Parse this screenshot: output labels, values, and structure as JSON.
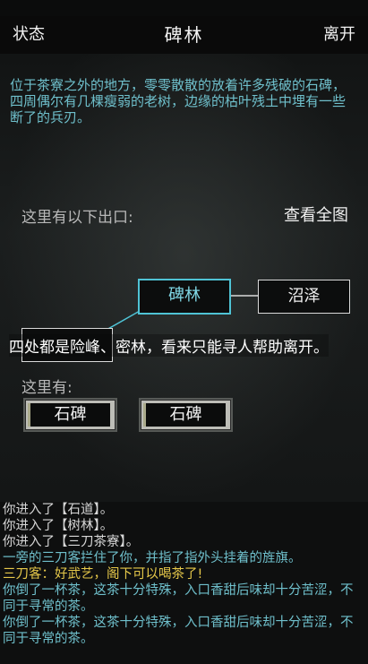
{
  "header": {
    "left_label": "状态",
    "title": "碑林",
    "right_label": "离开"
  },
  "description": "位于茶寮之外的地方，零零散散的放着许多残破的石碑，四周偶尔有几棵瘦弱的老树，边缘的枯叶残土中埋有一些断了的兵刃。",
  "exits": {
    "label": "这里有以下出口:",
    "full_map_label": "查看全图"
  },
  "map": {
    "current": "碑林",
    "nodes": [
      "沼泽",
      ""
    ],
    "colors": {
      "current": "#4fc3d5",
      "node_border": "#d9d9d9"
    }
  },
  "overlay_message": "四处都是险峰、密林，看来只能寻人帮助离开。",
  "here": {
    "label": "这里有:",
    "objects": [
      "石碑",
      "石碑"
    ]
  },
  "log": [
    {
      "text": "你进入了【石道】。",
      "color": "#d8d8d8"
    },
    {
      "text": "你进入了【树林】。",
      "color": "#d8d8d8"
    },
    {
      "text": "你进入了【三刀茶寮】。",
      "color": "#d8d8d8"
    },
    {
      "text": "一旁的三刀客拦住了你，并指了指外头挂着的旌旗。",
      "color": "#6fc0cc"
    },
    {
      "text": "三刀客：好武艺，阁下可以喝茶了!",
      "color": "#e6c84a"
    },
    {
      "text": "你倒了一杯茶，这茶十分特殊，入口香甜后味却十分苦涩，不同于寻常的茶。",
      "color": "#6fc0cc"
    },
    {
      "text": "你倒了一杯茶，这茶十分特殊，入口香甜后味却十分苦涩，不同于寻常的茶。",
      "color": "#6fc0cc"
    }
  ]
}
